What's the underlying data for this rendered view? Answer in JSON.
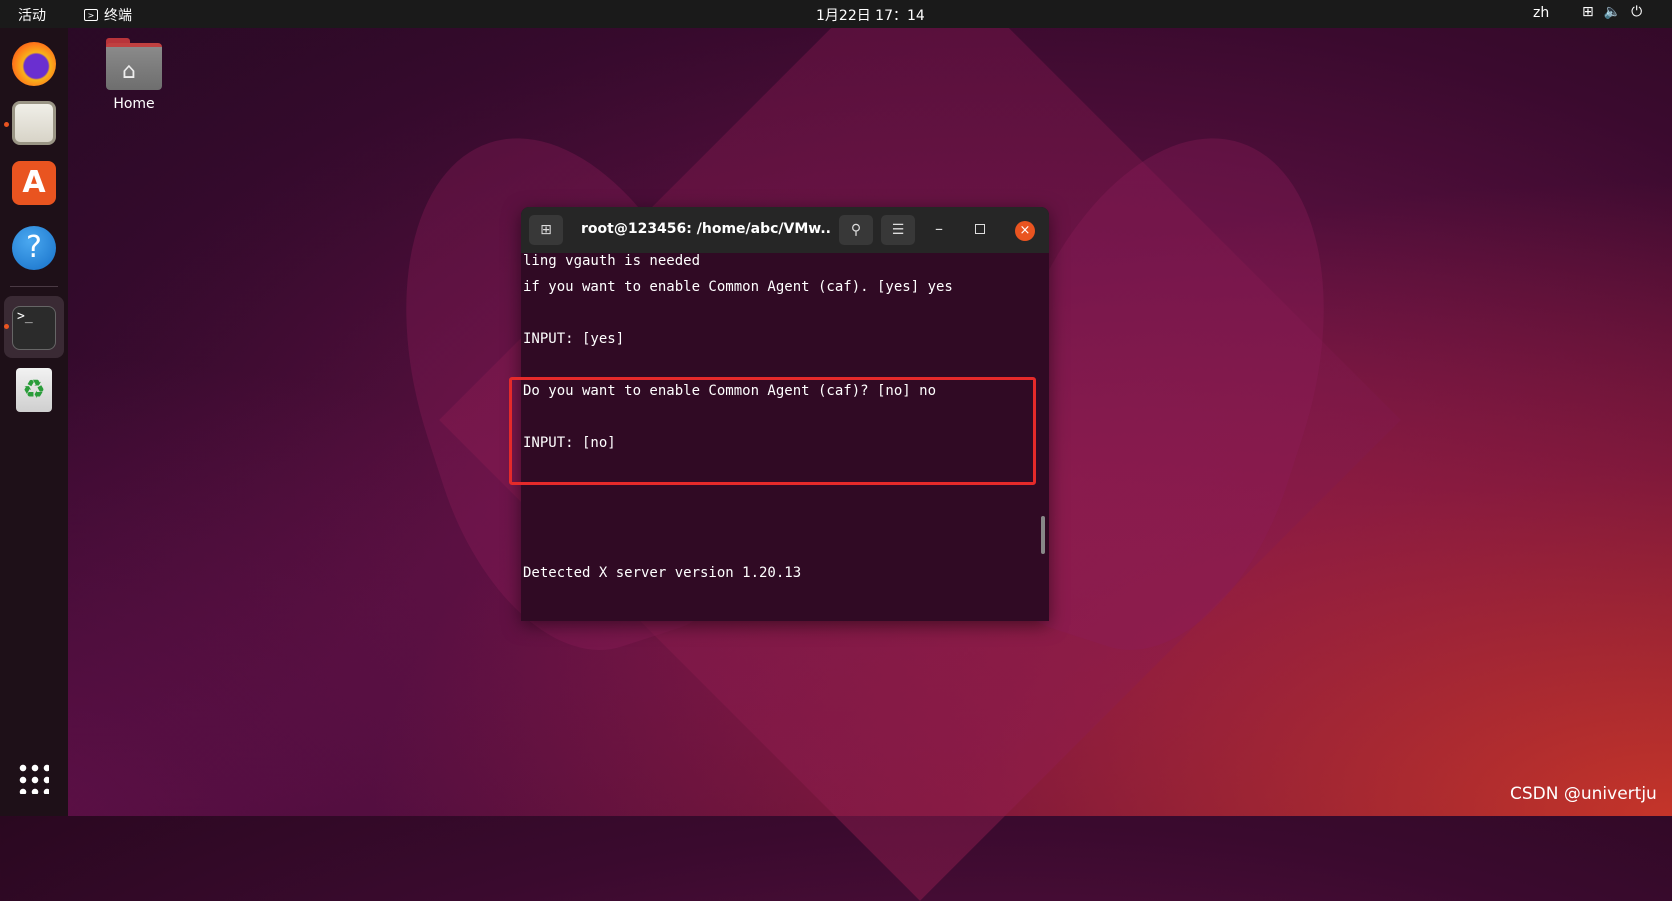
{
  "topbar": {
    "activities": "活动",
    "app_name": "终端",
    "clock": "1月22日  17：14",
    "lang": "zh",
    "network_icon": "network-icon",
    "volume_icon": "volume-icon",
    "power_icon": "power-icon"
  },
  "dock": {
    "items": [
      "firefox-icon",
      "files-icon",
      "app-store-icon",
      "help-icon",
      "terminal-icon",
      "trash-icon",
      "show-apps-icon"
    ],
    "terminal_glyph": ">_",
    "help_glyph": "?",
    "store_glyph": "A",
    "trash_glyph": "♻"
  },
  "desktop": {
    "home_label": "Home"
  },
  "terminal": {
    "title": "root@123456: /home/abc/VMw...",
    "lines": [
      "ling vgauth is needed",
      "if you want to enable Common Agent (caf). [yes] yes",
      "INPUT: [yes]",
      "Do you want to enable Common Agent (caf)? [no] no",
      "INPUT: [no]",
      "Detected X server version 1.20.13"
    ]
  },
  "accent": {
    "highlight_border": "#e52a2a",
    "ubuntu_orange": "#e95420",
    "terminal_bg": "#300a24"
  },
  "watermark": "CSDN @univertju"
}
